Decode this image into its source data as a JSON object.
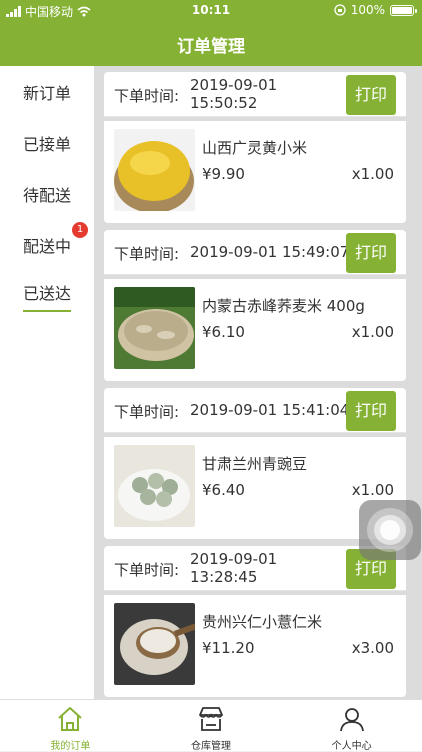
{
  "status": {
    "carrier": "中国移动",
    "time": "10:11",
    "battery": "100%"
  },
  "header": {
    "title": "订单管理"
  },
  "sidebar": {
    "items": [
      {
        "label": "新订单"
      },
      {
        "label": "已接单"
      },
      {
        "label": "待配送"
      },
      {
        "label": "配送中",
        "badge": "1"
      },
      {
        "label": "已送达"
      }
    ],
    "active": "已送达"
  },
  "orders": [
    {
      "time_label": "下单时间:",
      "time_line1": "2019-09-01",
      "time_line2": "15:50:52",
      "print_label": "打印",
      "product": "山西广灵黄小米",
      "price": "¥9.90",
      "qty": "x1.00",
      "image": "millet"
    },
    {
      "time_label": "下单时间:",
      "time_line1": "2019-09-01 15:49:07",
      "time_line2": "",
      "print_label": "打印",
      "product": "内蒙古赤峰荞麦米 400g",
      "price": "¥6.10",
      "qty": "x1.00",
      "image": "buckwheat"
    },
    {
      "time_label": "下单时间:",
      "time_line1": "2019-09-01 15:41:04",
      "time_line2": "",
      "print_label": "打印",
      "product": "甘肃兰州青豌豆",
      "price": "¥6.40",
      "qty": "x1.00",
      "image": "peas"
    },
    {
      "time_label": "下单时间:",
      "time_line1": "2019-09-01",
      "time_line2": "13:28:45",
      "print_label": "打印",
      "product": "贵州兴仁小薏仁米",
      "price": "¥11.20",
      "qty": "x3.00",
      "image": "coix"
    }
  ],
  "tabbar": {
    "items": [
      {
        "label": "我的订单",
        "icon": "home-icon"
      },
      {
        "label": "仓库管理",
        "icon": "store-icon"
      },
      {
        "label": "个人中心",
        "icon": "person-icon"
      }
    ],
    "active": "我的订单"
  },
  "colors": {
    "accent": "#85b234",
    "badge": "#e53a2f"
  }
}
